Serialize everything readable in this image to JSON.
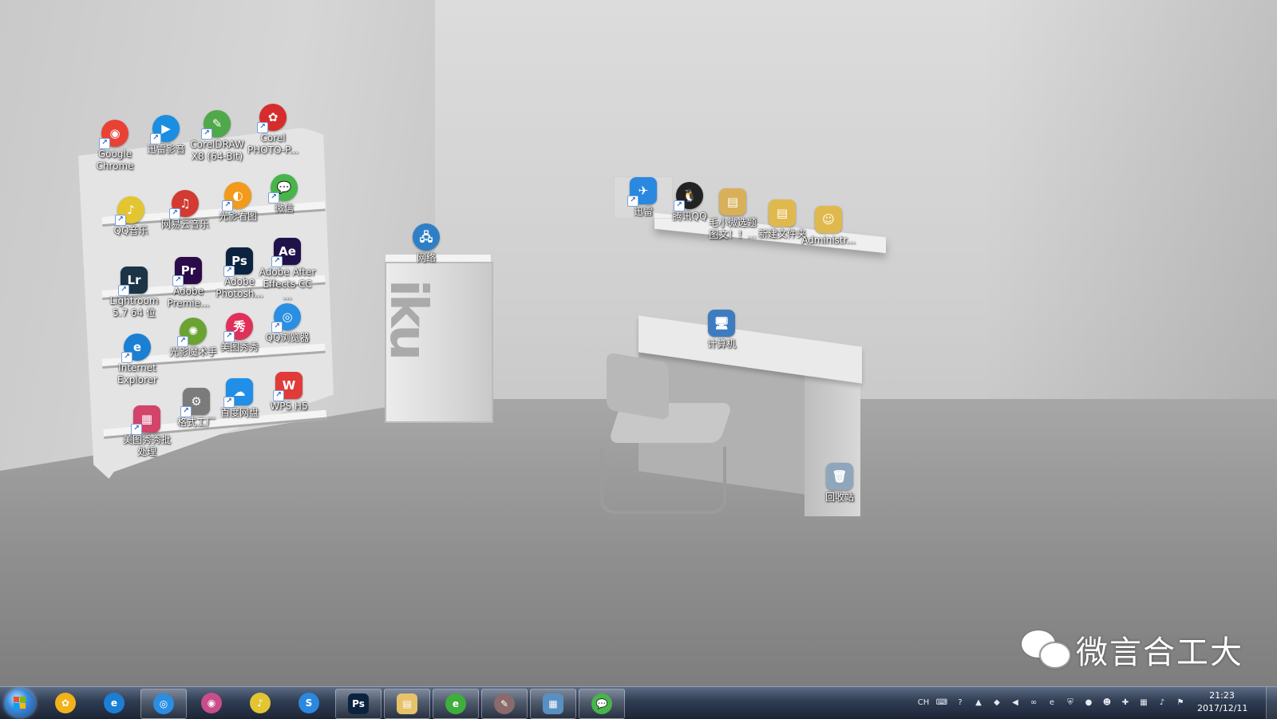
{
  "desktop_icons": [
    {
      "label": "Google\nChrome",
      "icon": "chrome-icon",
      "color": "#e94235",
      "glyph": "◉",
      "round": true
    },
    {
      "label": "迅雷影音",
      "icon": "xunlei-video-icon",
      "color": "#1a8ee0",
      "glyph": "▶",
      "round": true
    },
    {
      "label": "CorelDRAW\nX8 (64-Bit)",
      "icon": "coreldraw-icon",
      "color": "#4fa84a",
      "glyph": "✎",
      "round": true
    },
    {
      "label": "Corel\nPHOTO-P...",
      "icon": "corel-photo-paint-icon",
      "color": "#d72c2c",
      "glyph": "✿",
      "round": true
    },
    {
      "label": "QQ音乐",
      "icon": "qq-music-icon",
      "color": "#e2c531",
      "glyph": "♪",
      "round": true
    },
    {
      "label": "网易云音乐",
      "icon": "netease-music-icon",
      "color": "#d33a31",
      "glyph": "♫",
      "round": true
    },
    {
      "label": "光影看图",
      "icon": "guangying-viewer-icon",
      "color": "#f19a1c",
      "glyph": "◐",
      "round": true
    },
    {
      "label": "微信",
      "icon": "wechat-icon",
      "color": "#47b54b",
      "glyph": "💬",
      "round": true
    },
    {
      "label": "Lightroom\n5.7 64 位",
      "icon": "lightroom-icon",
      "color": "#1d3346",
      "glyph": "Lr",
      "round": false
    },
    {
      "label": "Adobe\nPremie...",
      "icon": "premiere-icon",
      "color": "#2b0b4a",
      "glyph": "Pr",
      "round": false
    },
    {
      "label": "Adobe\nPhotosh...",
      "icon": "photoshop-icon",
      "color": "#0c2340",
      "glyph": "Ps",
      "round": false
    },
    {
      "label": "Adobe After\nEffects CC ...",
      "icon": "after-effects-icon",
      "color": "#21114a",
      "glyph": "Ae",
      "round": false
    },
    {
      "label": "Internet\nExplorer",
      "icon": "internet-explorer-icon",
      "color": "#1b7fd4",
      "glyph": "e",
      "round": true
    },
    {
      "label": "光影魔术手",
      "icon": "guangying-magic-icon",
      "color": "#6aa332",
      "glyph": "✺",
      "round": true
    },
    {
      "label": "美图秀秀",
      "icon": "meitu-icon",
      "color": "#e0305a",
      "glyph": "秀",
      "round": true
    },
    {
      "label": "QQ浏览器",
      "icon": "qq-browser-icon",
      "color": "#2a8fe3",
      "glyph": "◎",
      "round": true
    },
    {
      "label": "美图秀秀批\n处理",
      "icon": "meitu-batch-icon",
      "color": "#d24469",
      "glyph": "▦",
      "round": false
    },
    {
      "label": "格式工厂",
      "icon": "format-factory-icon",
      "color": "#7b7b7b",
      "glyph": "⚙",
      "round": false
    },
    {
      "label": "百度网盘",
      "icon": "baidu-netdisk-icon",
      "color": "#1f8fe8",
      "glyph": "☁",
      "round": false
    },
    {
      "label": "WPS H5",
      "icon": "wps-h5-icon",
      "color": "#e03a3a",
      "glyph": "W",
      "round": false
    },
    {
      "label": "网络",
      "icon": "network-icon",
      "color": "#2f7fc6",
      "glyph": "🖧",
      "round": true
    },
    {
      "label": "迅雷",
      "icon": "xunlei-icon",
      "color": "#2b88e0",
      "glyph": "✈",
      "round": false
    },
    {
      "label": "腾讯QQ",
      "icon": "qq-icon",
      "color": "#222222",
      "glyph": "🐧",
      "round": true
    },
    {
      "label": "毛小微选题\n图文！！...",
      "icon": "folder-topic-icon",
      "color": "#d8b05a",
      "glyph": "▤",
      "round": false
    },
    {
      "label": "新建文件夹",
      "icon": "new-folder-icon",
      "color": "#e0b94e",
      "glyph": "▤",
      "round": false
    },
    {
      "label": "Administr...",
      "icon": "administrator-folder-icon",
      "color": "#e0b94e",
      "glyph": "☺",
      "round": false
    },
    {
      "label": "计算机",
      "icon": "computer-icon",
      "color": "#3d7dbf",
      "glyph": "🖥",
      "round": false
    },
    {
      "label": "回收站",
      "icon": "recycle-bin-icon",
      "color": "#8fa6bb",
      "glyph": "🗑",
      "round": false
    }
  ],
  "wallpaper": {
    "mark": "iku"
  },
  "watermark": {
    "text": "微言合工大",
    "icon": "wechat-logo-icon"
  },
  "taskbar": {
    "start_icon": "windows-start-icon",
    "items": [
      {
        "name": "windows-photo-gallery-icon",
        "color": "#f2b21b",
        "glyph": "✿",
        "round": true,
        "state": "pinned"
      },
      {
        "name": "internet-explorer-icon",
        "color": "#1b7fd4",
        "glyph": "e",
        "round": true,
        "state": "pinned"
      },
      {
        "name": "qq-browser-icon",
        "color": "#2a8fe3",
        "glyph": "◎",
        "round": true,
        "state": "running"
      },
      {
        "name": "color-wheel-icon",
        "color": "#c94d8a",
        "glyph": "◉",
        "round": true,
        "state": "pinned"
      },
      {
        "name": "qq-music-icon",
        "color": "#e2c531",
        "glyph": "♪",
        "round": true,
        "state": "pinned"
      },
      {
        "name": "sogou-input-icon",
        "color": "#2b88e0",
        "glyph": "S",
        "round": true,
        "state": "pinned"
      },
      {
        "name": "photoshop-icon",
        "color": "#0c2340",
        "glyph": "Ps",
        "round": false,
        "state": "running"
      },
      {
        "name": "file-explorer-icon",
        "color": "#e6c26b",
        "glyph": "▤",
        "round": false,
        "state": "running"
      },
      {
        "name": "browser-360-icon",
        "color": "#3fae3c",
        "glyph": "e",
        "round": true,
        "state": "running"
      },
      {
        "name": "xiuxiu-app-icon",
        "color": "#8a6a6a",
        "glyph": "✎",
        "round": true,
        "state": "running"
      },
      {
        "name": "control-panel-icon",
        "color": "#5a8fc2",
        "glyph": "▦",
        "round": false,
        "state": "running"
      },
      {
        "name": "wechat-icon",
        "color": "#47b54b",
        "glyph": "💬",
        "round": true,
        "state": "running"
      }
    ],
    "tray": [
      {
        "name": "input-method-ch",
        "text": "CH"
      },
      {
        "name": "keyboard-icon",
        "text": "⌨"
      },
      {
        "name": "help-icon",
        "text": "?"
      },
      {
        "name": "show-hidden-icons",
        "text": "▲"
      },
      {
        "name": "box-icon",
        "text": "◆"
      },
      {
        "name": "volume-mute-icon",
        "text": "◀"
      },
      {
        "name": "link-icon",
        "text": "∞"
      },
      {
        "name": "browser-tray-icon",
        "text": "e"
      },
      {
        "name": "shield-icon",
        "text": "⛨"
      },
      {
        "name": "wechat-tray-icon",
        "text": "●"
      },
      {
        "name": "qq-tray-icon",
        "text": "☻"
      },
      {
        "name": "sync-tray-icon",
        "text": "✚"
      },
      {
        "name": "network-tray-icon",
        "text": "▦"
      },
      {
        "name": "speaker-icon",
        "text": "♪"
      },
      {
        "name": "action-center-icon",
        "text": "⚑"
      }
    ],
    "clock": {
      "time": "21:23",
      "date": "2017/12/11"
    }
  }
}
